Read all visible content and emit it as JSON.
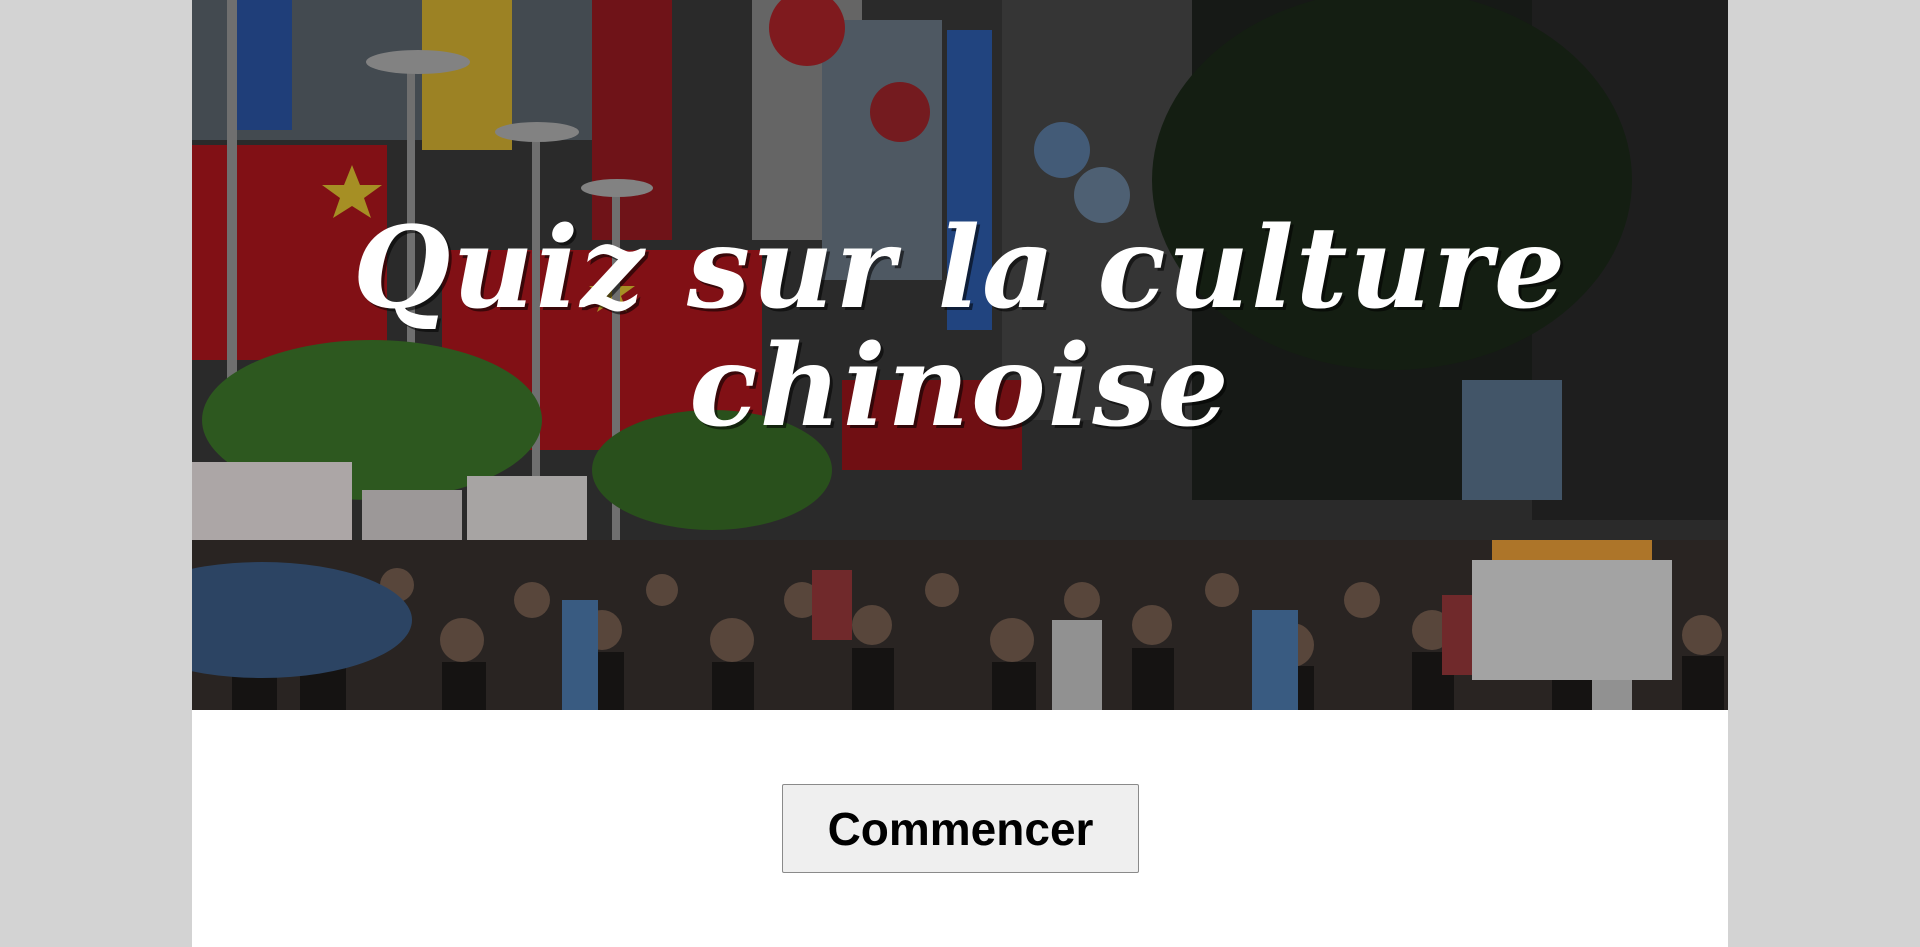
{
  "hero": {
    "title": "Quiz sur la culture chinoise",
    "image": "crowded-shopping-street-photo",
    "colors": {
      "banner_red": "#b3171e",
      "sign_yellow": "#d9b532",
      "sign_blue": "#2f5fb0",
      "foliage": "#3f7a2b",
      "title_text": "#ffffff"
    }
  },
  "actions": {
    "start_label": "Commencer"
  },
  "colors": {
    "outer_background": "#d3d3d3",
    "page_background": "#ffffff",
    "button_background": "#efefef"
  }
}
